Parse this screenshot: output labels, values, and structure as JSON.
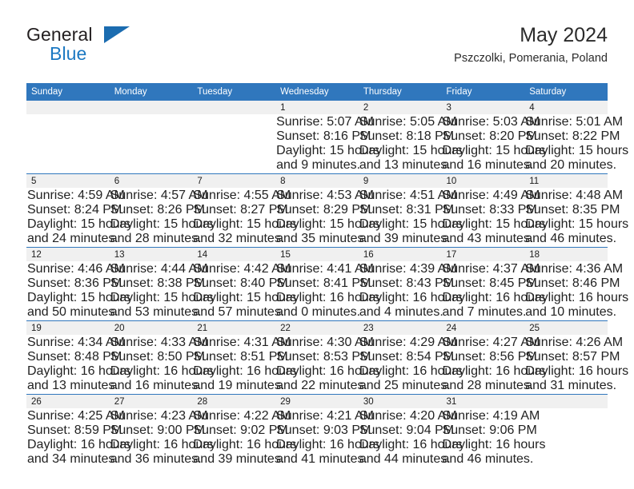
{
  "brand": {
    "name_top": "General",
    "name_bottom": "Blue",
    "triangle_icon": "brand-triangle-icon",
    "accent_color": "#1b78c2"
  },
  "header": {
    "title": "May 2024",
    "location": "Pszczolki, Pomerania, Poland"
  },
  "theme": {
    "header_blue": "#3077bd",
    "daynum_band": "#f0f0f0",
    "text": "#1c1c1c"
  },
  "calendar": {
    "weekday_headers": [
      "Sunday",
      "Monday",
      "Tuesday",
      "Wednesday",
      "Thursday",
      "Friday",
      "Saturday"
    ],
    "weeks": [
      [
        {
          "day": "",
          "lines": []
        },
        {
          "day": "",
          "lines": []
        },
        {
          "day": "",
          "lines": []
        },
        {
          "day": "1",
          "lines": [
            "Sunrise: 5:07 AM",
            "Sunset: 8:16 PM",
            "Daylight: 15 hours",
            "and 9 minutes."
          ]
        },
        {
          "day": "2",
          "lines": [
            "Sunrise: 5:05 AM",
            "Sunset: 8:18 PM",
            "Daylight: 15 hours",
            "and 13 minutes."
          ]
        },
        {
          "day": "3",
          "lines": [
            "Sunrise: 5:03 AM",
            "Sunset: 8:20 PM",
            "Daylight: 15 hours",
            "and 16 minutes."
          ]
        },
        {
          "day": "4",
          "lines": [
            "Sunrise: 5:01 AM",
            "Sunset: 8:22 PM",
            "Daylight: 15 hours",
            "and 20 minutes."
          ]
        }
      ],
      [
        {
          "day": "5",
          "lines": [
            "Sunrise: 4:59 AM",
            "Sunset: 8:24 PM",
            "Daylight: 15 hours",
            "and 24 minutes."
          ]
        },
        {
          "day": "6",
          "lines": [
            "Sunrise: 4:57 AM",
            "Sunset: 8:26 PM",
            "Daylight: 15 hours",
            "and 28 minutes."
          ]
        },
        {
          "day": "7",
          "lines": [
            "Sunrise: 4:55 AM",
            "Sunset: 8:27 PM",
            "Daylight: 15 hours",
            "and 32 minutes."
          ]
        },
        {
          "day": "8",
          "lines": [
            "Sunrise: 4:53 AM",
            "Sunset: 8:29 PM",
            "Daylight: 15 hours",
            "and 35 minutes."
          ]
        },
        {
          "day": "9",
          "lines": [
            "Sunrise: 4:51 AM",
            "Sunset: 8:31 PM",
            "Daylight: 15 hours",
            "and 39 minutes."
          ]
        },
        {
          "day": "10",
          "lines": [
            "Sunrise: 4:49 AM",
            "Sunset: 8:33 PM",
            "Daylight: 15 hours",
            "and 43 minutes."
          ]
        },
        {
          "day": "11",
          "lines": [
            "Sunrise: 4:48 AM",
            "Sunset: 8:35 PM",
            "Daylight: 15 hours",
            "and 46 minutes."
          ]
        }
      ],
      [
        {
          "day": "12",
          "lines": [
            "Sunrise: 4:46 AM",
            "Sunset: 8:36 PM",
            "Daylight: 15 hours",
            "and 50 minutes."
          ]
        },
        {
          "day": "13",
          "lines": [
            "Sunrise: 4:44 AM",
            "Sunset: 8:38 PM",
            "Daylight: 15 hours",
            "and 53 minutes."
          ]
        },
        {
          "day": "14",
          "lines": [
            "Sunrise: 4:42 AM",
            "Sunset: 8:40 PM",
            "Daylight: 15 hours",
            "and 57 minutes."
          ]
        },
        {
          "day": "15",
          "lines": [
            "Sunrise: 4:41 AM",
            "Sunset: 8:41 PM",
            "Daylight: 16 hours",
            "and 0 minutes."
          ]
        },
        {
          "day": "16",
          "lines": [
            "Sunrise: 4:39 AM",
            "Sunset: 8:43 PM",
            "Daylight: 16 hours",
            "and 4 minutes."
          ]
        },
        {
          "day": "17",
          "lines": [
            "Sunrise: 4:37 AM",
            "Sunset: 8:45 PM",
            "Daylight: 16 hours",
            "and 7 minutes."
          ]
        },
        {
          "day": "18",
          "lines": [
            "Sunrise: 4:36 AM",
            "Sunset: 8:46 PM",
            "Daylight: 16 hours",
            "and 10 minutes."
          ]
        }
      ],
      [
        {
          "day": "19",
          "lines": [
            "Sunrise: 4:34 AM",
            "Sunset: 8:48 PM",
            "Daylight: 16 hours",
            "and 13 minutes."
          ]
        },
        {
          "day": "20",
          "lines": [
            "Sunrise: 4:33 AM",
            "Sunset: 8:50 PM",
            "Daylight: 16 hours",
            "and 16 minutes."
          ]
        },
        {
          "day": "21",
          "lines": [
            "Sunrise: 4:31 AM",
            "Sunset: 8:51 PM",
            "Daylight: 16 hours",
            "and 19 minutes."
          ]
        },
        {
          "day": "22",
          "lines": [
            "Sunrise: 4:30 AM",
            "Sunset: 8:53 PM",
            "Daylight: 16 hours",
            "and 22 minutes."
          ]
        },
        {
          "day": "23",
          "lines": [
            "Sunrise: 4:29 AM",
            "Sunset: 8:54 PM",
            "Daylight: 16 hours",
            "and 25 minutes."
          ]
        },
        {
          "day": "24",
          "lines": [
            "Sunrise: 4:27 AM",
            "Sunset: 8:56 PM",
            "Daylight: 16 hours",
            "and 28 minutes."
          ]
        },
        {
          "day": "25",
          "lines": [
            "Sunrise: 4:26 AM",
            "Sunset: 8:57 PM",
            "Daylight: 16 hours",
            "and 31 minutes."
          ]
        }
      ],
      [
        {
          "day": "26",
          "lines": [
            "Sunrise: 4:25 AM",
            "Sunset: 8:59 PM",
            "Daylight: 16 hours",
            "and 34 minutes."
          ]
        },
        {
          "day": "27",
          "lines": [
            "Sunrise: 4:23 AM",
            "Sunset: 9:00 PM",
            "Daylight: 16 hours",
            "and 36 minutes."
          ]
        },
        {
          "day": "28",
          "lines": [
            "Sunrise: 4:22 AM",
            "Sunset: 9:02 PM",
            "Daylight: 16 hours",
            "and 39 minutes."
          ]
        },
        {
          "day": "29",
          "lines": [
            "Sunrise: 4:21 AM",
            "Sunset: 9:03 PM",
            "Daylight: 16 hours",
            "and 41 minutes."
          ]
        },
        {
          "day": "30",
          "lines": [
            "Sunrise: 4:20 AM",
            "Sunset: 9:04 PM",
            "Daylight: 16 hours",
            "and 44 minutes."
          ]
        },
        {
          "day": "31",
          "lines": [
            "Sunrise: 4:19 AM",
            "Sunset: 9:06 PM",
            "Daylight: 16 hours",
            "and 46 minutes."
          ]
        },
        {
          "day": "",
          "lines": []
        }
      ]
    ]
  }
}
